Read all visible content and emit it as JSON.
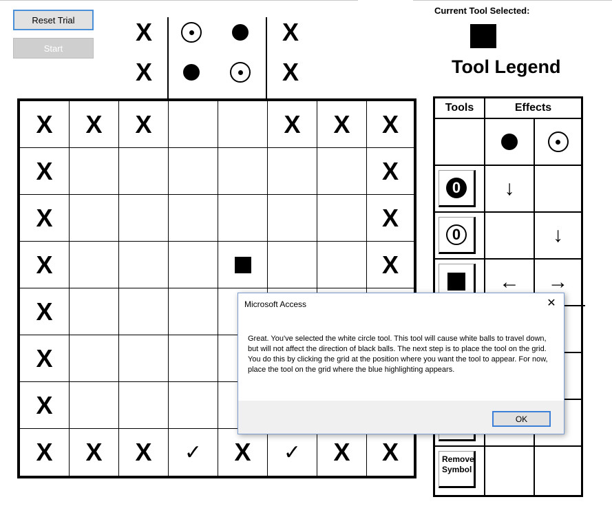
{
  "controls": {
    "reset_label": "Reset Trial",
    "start_label": "Start"
  },
  "top_area": {
    "rows": [
      [
        "X",
        "circled-dot",
        "black-dot",
        "X"
      ],
      [
        "X",
        "black-dot",
        "circled-dot",
        "X"
      ]
    ],
    "x_label": "X"
  },
  "grid": {
    "rows": [
      [
        "X",
        "X",
        "X",
        "",
        "",
        "X",
        "X",
        "X"
      ],
      [
        "X",
        "",
        "",
        "",
        "",
        "",
        "",
        "X"
      ],
      [
        "X",
        "",
        "",
        "",
        "",
        "",
        "",
        "X"
      ],
      [
        "X",
        "",
        "",
        "",
        "square",
        "",
        "",
        "X"
      ],
      [
        "X",
        "",
        "",
        "",
        "",
        "",
        "",
        "X"
      ],
      [
        "X",
        "",
        "",
        "",
        "",
        "",
        "",
        "X"
      ],
      [
        "X",
        "",
        "",
        "",
        "",
        "",
        "",
        "X"
      ],
      [
        "X",
        "X",
        "X",
        "✓",
        "X",
        "✓",
        "X",
        "X"
      ]
    ]
  },
  "tool": {
    "label": "Current Tool Selected:",
    "selected_icon": "black-square-icon"
  },
  "legend": {
    "title": "Tool Legend",
    "col_tools": "Tools",
    "col_effects": "Effects",
    "rows": [
      {
        "tool": "",
        "effect_black": "black-dot",
        "effect_white": "circled-dot"
      },
      {
        "tool": "black-zero-circle",
        "tool_text": "0",
        "effect_black": "↓",
        "effect_white": ""
      },
      {
        "tool": "white-zero-circle",
        "tool_text": "0",
        "effect_black": "",
        "effect_white": "↓"
      },
      {
        "tool": "black-square",
        "effect_black": "←",
        "effect_white": "→"
      },
      {
        "tool": "hidden",
        "effect_black": "",
        "effect_white": ""
      },
      {
        "tool": "hidden",
        "effect_black": "",
        "effect_white": ""
      },
      {
        "tool": "hidden",
        "effect_black": "",
        "effect_white": ""
      },
      {
        "tool": "remove",
        "tool_text_1": "Remove",
        "tool_text_2": "Symbol",
        "effect_black": "",
        "effect_white": ""
      }
    ]
  },
  "dialog": {
    "title": "Microsoft Access",
    "close_glyph": "✕",
    "message": "Great. You've selected the white circle tool.  This tool will cause white balls to travel down, but will not affect the direction of black balls.  The next step is to place the tool on the grid.  You do this by clicking the grid at the position where you want the tool to appear.  For now, place the tool on the grid where the blue highlighting appears.",
    "ok_label": "OK"
  }
}
